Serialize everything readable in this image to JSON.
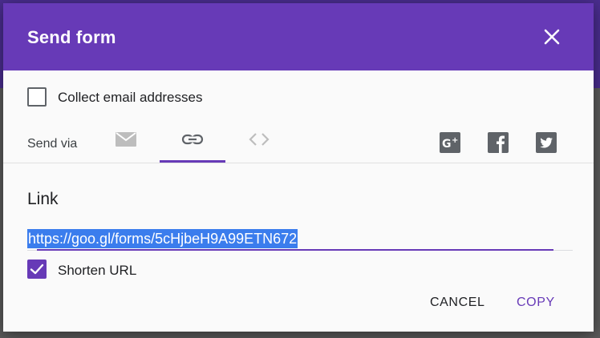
{
  "dialog": {
    "title": "Send form"
  },
  "collect_email": {
    "label": "Collect email addresses",
    "checked": false
  },
  "send_via": {
    "label": "Send via",
    "tabs": [
      {
        "icon": "email-icon",
        "active": false
      },
      {
        "icon": "link-icon",
        "active": true
      },
      {
        "icon": "embed-code-icon",
        "active": false
      }
    ],
    "share": [
      {
        "icon": "google-plus-icon"
      },
      {
        "icon": "facebook-icon"
      },
      {
        "icon": "twitter-icon"
      }
    ]
  },
  "link_section": {
    "heading": "Link",
    "url": "https://goo.gl/forms/5cHjbeH9A99ETN672",
    "shorten_label": "Shorten URL",
    "shorten_checked": true
  },
  "actions": {
    "cancel_label": "CANCEL",
    "copy_label": "COPY"
  },
  "colors": {
    "accent": "#673ab7",
    "selection": "#3b7ded",
    "icon_gray": "#5f6368"
  }
}
